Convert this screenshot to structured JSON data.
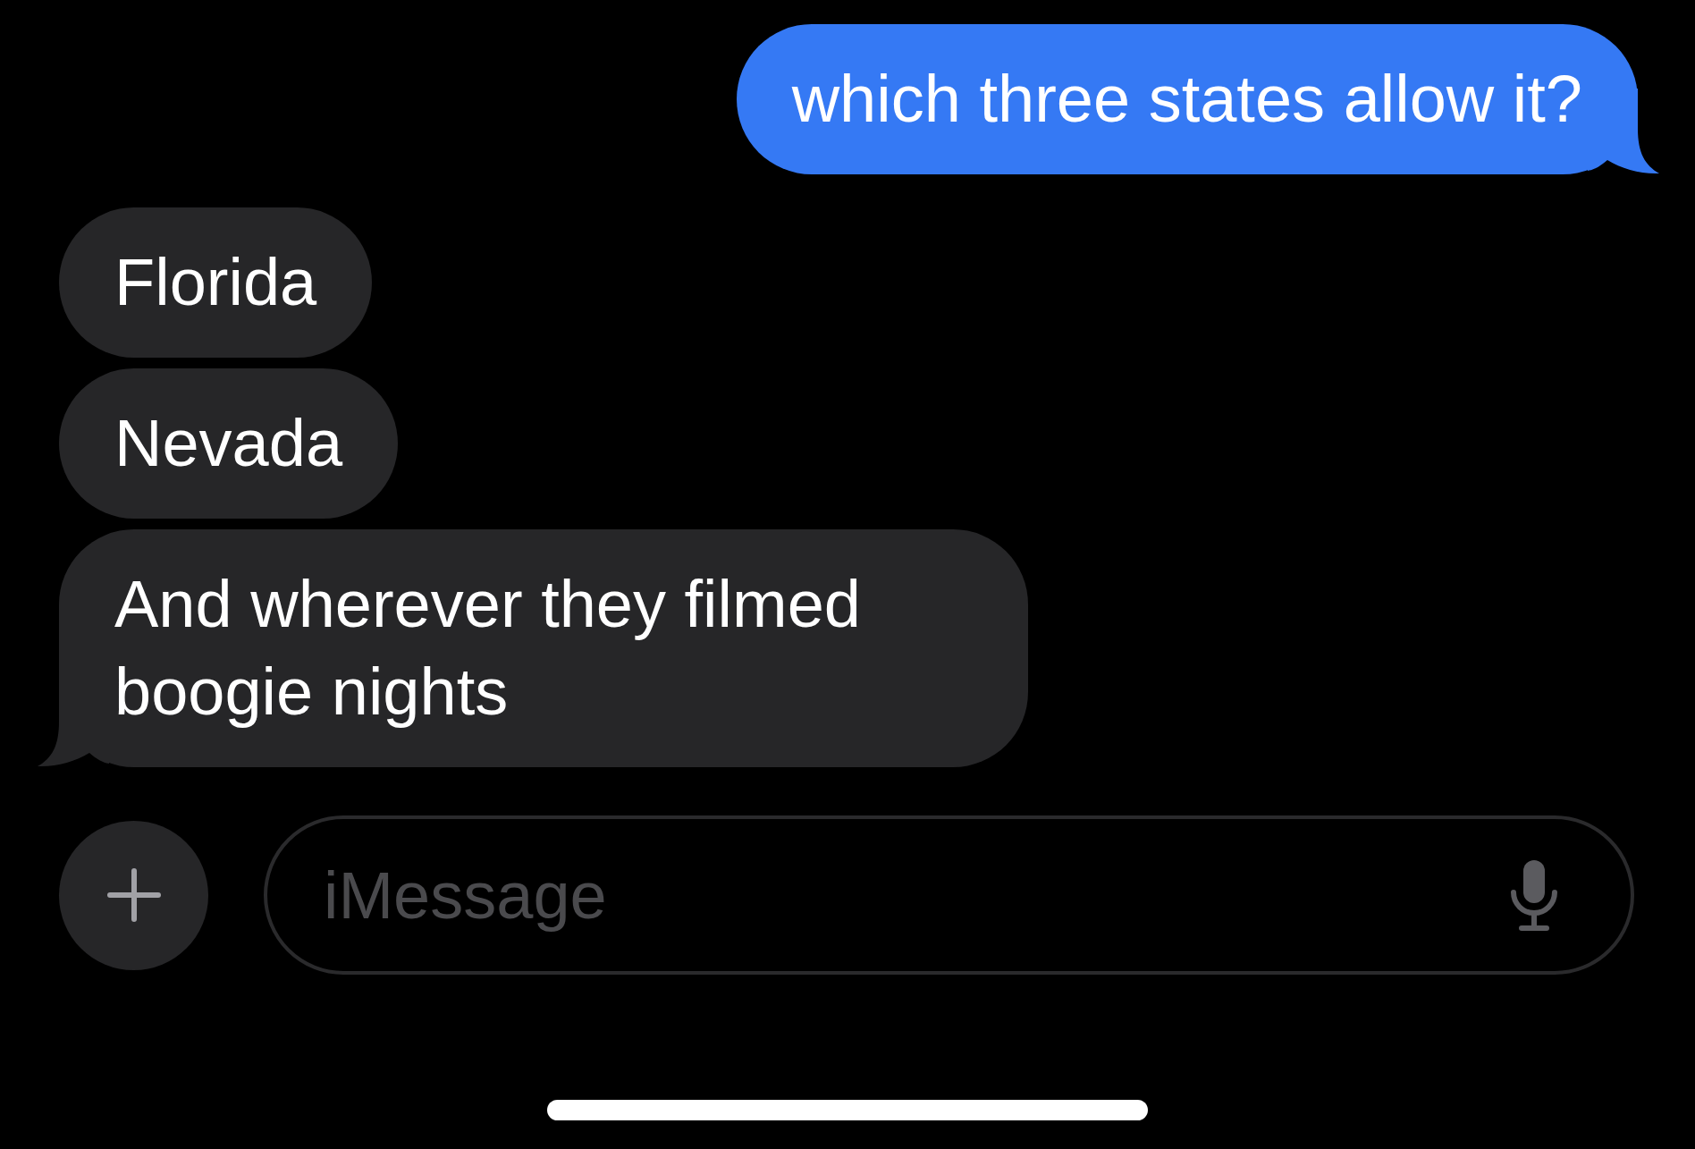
{
  "messages": [
    {
      "kind": "sent",
      "text": "which three states allow it?",
      "tail": true
    },
    {
      "kind": "received",
      "text": "Florida",
      "tail": false
    },
    {
      "kind": "received",
      "text": "Nevada",
      "tail": false
    },
    {
      "kind": "received",
      "text": "And wherever they filmed boogie nights",
      "tail": true
    }
  ],
  "composer": {
    "placeholder": "iMessage"
  }
}
